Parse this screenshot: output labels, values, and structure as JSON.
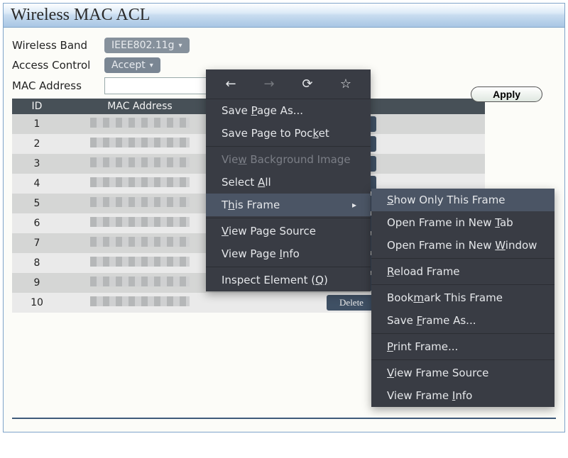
{
  "page_title": "Wireless MAC ACL",
  "form": {
    "band_label": "Wireless Band",
    "band_value": "IEEE802.11g",
    "ac_label": "Access Control",
    "ac_value": "Accept",
    "mac_label": "MAC Address",
    "mac_value": "",
    "apply": "Apply"
  },
  "th": {
    "id": "ID",
    "mac": "MAC Address"
  },
  "row_ids": [
    "1",
    "2",
    "3",
    "4",
    "5",
    "6",
    "7",
    "8",
    "9",
    "10"
  ],
  "delete_label": "Delete",
  "ctx": {
    "save_as_pre": "Save ",
    "save_as_u": "P",
    "save_as_post": "age As...",
    "pocket_pre": "Save Page to Poc",
    "pocket_u": "k",
    "pocket_post": "et",
    "bg_pre": "Vie",
    "bg_u": "w",
    "bg_post": " Background Image",
    "selall_pre": "Select ",
    "selall_u": "A",
    "selall_post": "ll",
    "frame_pre": "T",
    "frame_u": "h",
    "frame_post": "is Frame",
    "src_pre": "",
    "src_u": "V",
    "src_post": "iew Page Source",
    "info_pre": "View Page ",
    "info_u": "I",
    "info_post": "nfo",
    "inspect_pre": "Inspect Element (",
    "inspect_u": "Q",
    "inspect_post": ")"
  },
  "sub": {
    "show_pre": "",
    "show_u": "S",
    "show_post": "how Only This Frame",
    "tab_pre": "Open Frame in New ",
    "tab_u": "T",
    "tab_post": "ab",
    "win_pre": "Open Frame in New ",
    "win_u": "W",
    "win_post": "indow",
    "reload_pre": "",
    "reload_u": "R",
    "reload_post": "eload Frame",
    "bm_pre": "Book",
    "bm_u": "m",
    "bm_post": "ark This Frame",
    "saveas_pre": "Save ",
    "saveas_u": "F",
    "saveas_post": "rame As...",
    "print_pre": "",
    "print_u": "P",
    "print_post": "rint Frame...",
    "vsrc_pre": "",
    "vsrc_u": "V",
    "vsrc_post": "iew Frame Source",
    "vinfo_pre": "View Frame ",
    "vinfo_u": "I",
    "vinfo_post": "nfo"
  }
}
